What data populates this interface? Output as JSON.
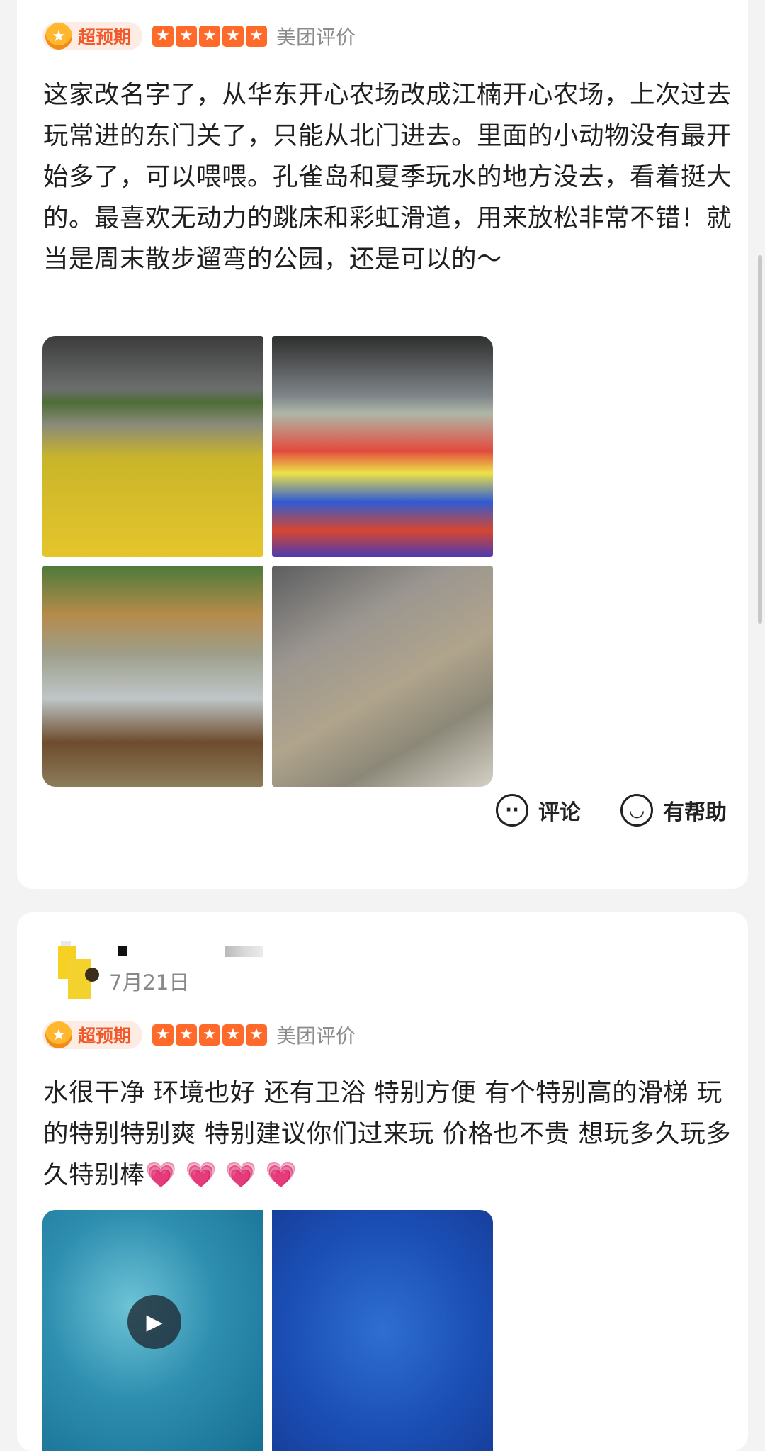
{
  "review1": {
    "badge": "超预期",
    "source": "美团评价",
    "text": "这家改名字了，从华东开心农场改成江楠开心农场，上次过去玩常进的东门关了，只能从北门进去。里面的小动物没有最开始多了，可以喂喂。孔雀岛和夏季玩水的地方没去，看着挺大的。最喜欢无动力的跳床和彩虹滑道，用来放松非常不错！就当是周末散步遛弯的公园，还是可以的～",
    "rating": 5,
    "actions": {
      "comment": "评论",
      "helpful": "有帮助"
    }
  },
  "review2": {
    "date": "7月21日",
    "badge": "超预期",
    "source": "美团评价",
    "text": "水很干净 环境也好 还有卫浴 特别方便 有个特别高的滑梯 玩的特别特别爽 特别建议你们过来玩 价格也不贵 想玩多久玩多久特别棒💗 💗 💗 💗",
    "rating": 5
  },
  "icons": {
    "crown": "crown-icon",
    "star": "star-icon",
    "comment": "comment-bubble-icon",
    "helpful": "smiley-icon",
    "play": "play-icon"
  },
  "colors": {
    "badge_text": "#f2592a",
    "star": "#ff6a2b",
    "muted": "#8c8c8c"
  }
}
